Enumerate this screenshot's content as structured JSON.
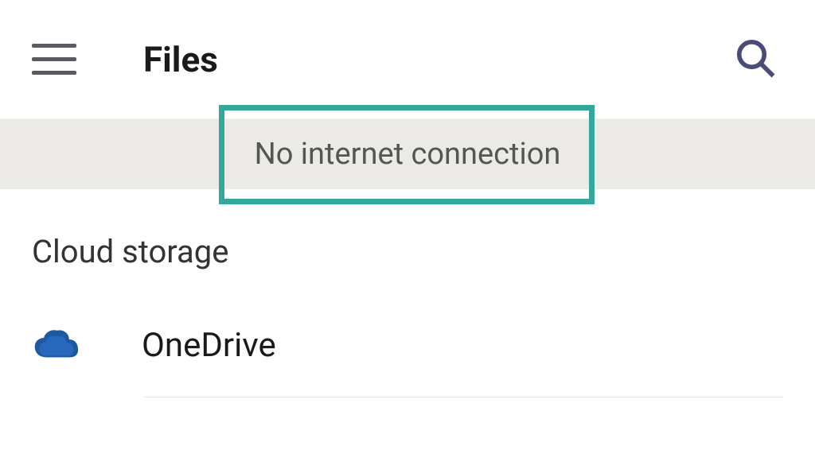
{
  "header": {
    "title": "Files"
  },
  "banner": {
    "message": "No internet connection"
  },
  "section": {
    "title": "Cloud storage"
  },
  "items": [
    {
      "label": "OneDrive"
    }
  ]
}
